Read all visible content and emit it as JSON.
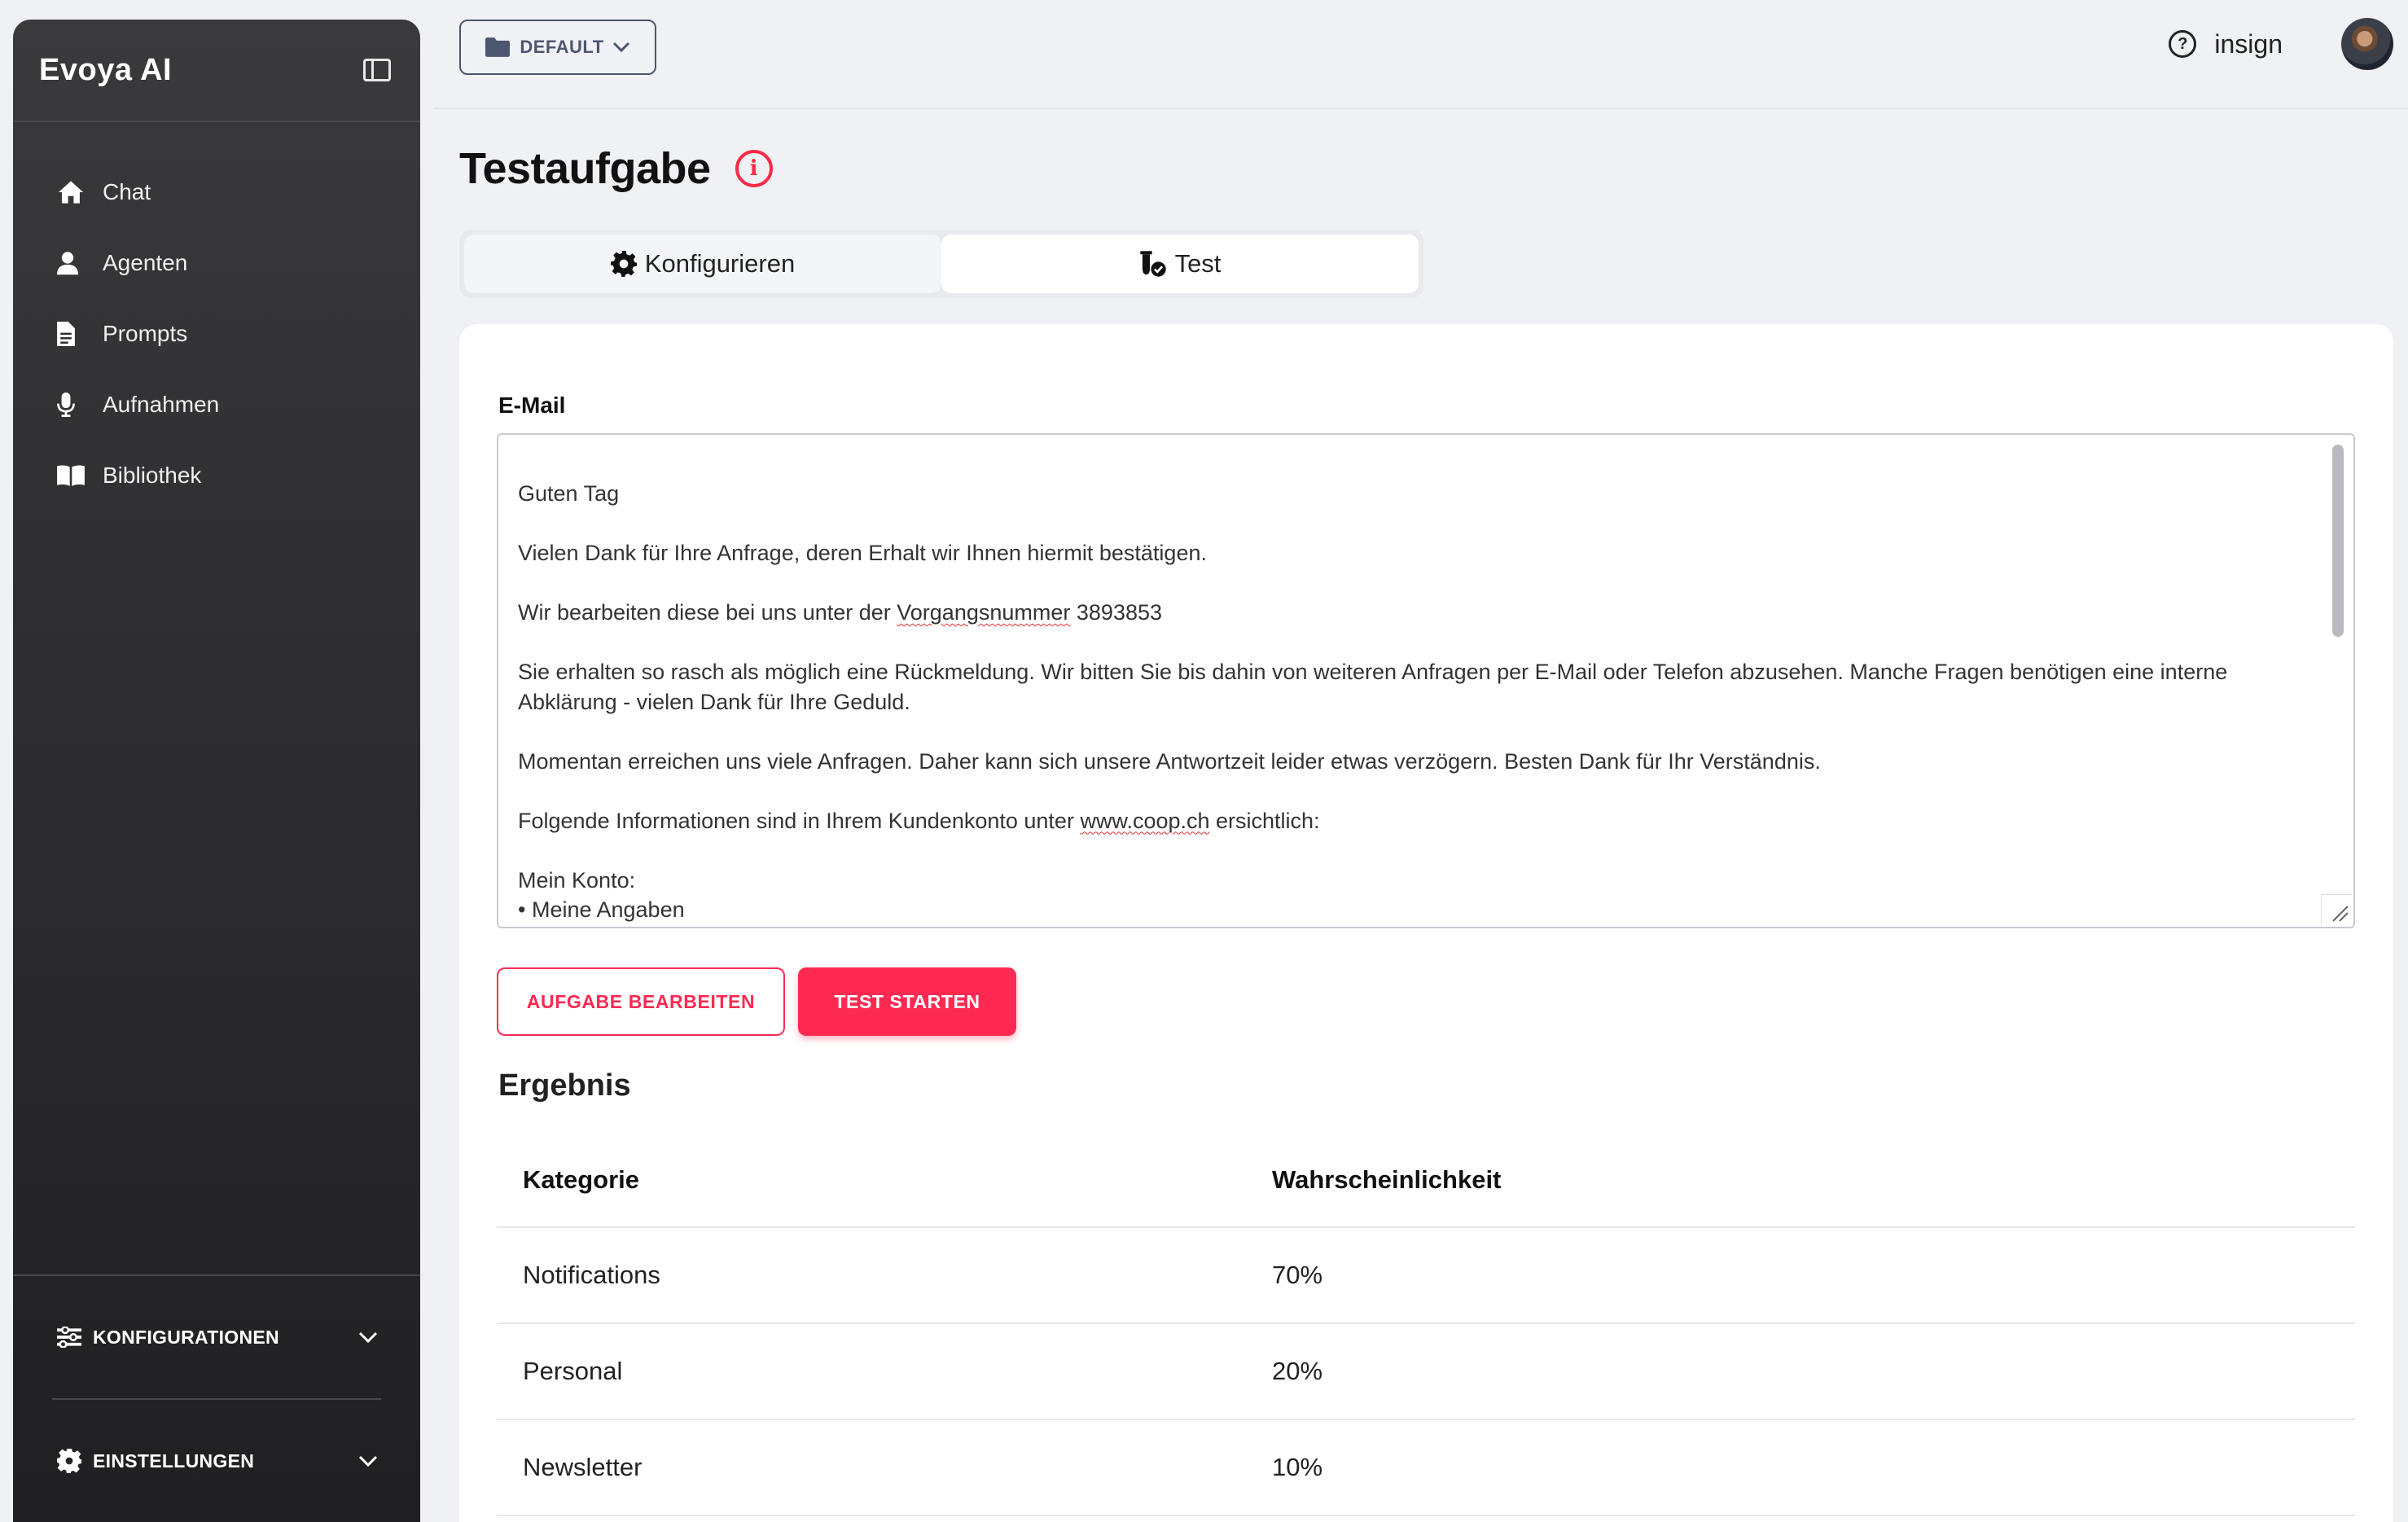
{
  "sidebar": {
    "title": "Evoya AI",
    "items": [
      {
        "label": "Chat",
        "icon": "home-icon"
      },
      {
        "label": "Agenten",
        "icon": "user-icon"
      },
      {
        "label": "Prompts",
        "icon": "document-icon"
      },
      {
        "label": "Aufnahmen",
        "icon": "microphone-icon"
      },
      {
        "label": "Bibliothek",
        "icon": "book-icon"
      }
    ],
    "sections": [
      {
        "label": "KONFIGURATIONEN",
        "icon": "sliders-icon"
      },
      {
        "label": "EINSTELLUNGEN",
        "icon": "gear-icon"
      }
    ]
  },
  "topbar": {
    "workspace_label": "DEFAULT",
    "user_name": "insign"
  },
  "page": {
    "title": "Testaufgabe",
    "tabs": [
      {
        "label": "Konfigurieren",
        "icon": "gear-icon",
        "active": false
      },
      {
        "label": "Test",
        "icon": "flask-check-icon",
        "active": true
      }
    ]
  },
  "form": {
    "email_label": "E-Mail",
    "email_lines": {
      "l1": "Guten Tag",
      "l2": "Vielen Dank für Ihre Anfrage, deren Erhalt wir Ihnen hiermit bestätigen.",
      "l3a": "Wir bearbeiten diese bei uns unter der ",
      "l3b": "Vorgangsnummer",
      "l3c": " 3893853",
      "l4": "Sie erhalten so rasch als möglich eine Rückmeldung. Wir bitten Sie bis dahin von weiteren Anfragen per E-Mail oder Telefon abzusehen. Manche Fragen benötigen eine interne Abklärung - vielen Dank für Ihre Geduld.",
      "l5": "Momentan erreichen uns viele Anfragen. Daher kann sich unsere Antwortzeit leider etwas verzögern. Besten Dank für Ihr Verständnis.",
      "l6a": "Folgende Informationen sind in Ihrem Kundenkonto unter ",
      "l6b": "www.coop.ch",
      "l6c": " ersichtlich:",
      "l7": "Mein Konto:",
      "l8": "• Meine Angaben"
    },
    "edit_button": "AUFGABE BEARBEITEN",
    "start_button": "TEST STARTEN"
  },
  "result": {
    "title": "Ergebnis",
    "columns": [
      "Kategorie",
      "Wahrscheinlichkeit"
    ],
    "rows": [
      [
        "Notifications",
        "70%"
      ],
      [
        "Personal",
        "20%"
      ],
      [
        "Newsletter",
        "10%"
      ]
    ]
  },
  "colors": {
    "accent": "#ff2a52",
    "sidebar_bg": "#2c2c2e",
    "page_bg": "#f0f1f5"
  }
}
